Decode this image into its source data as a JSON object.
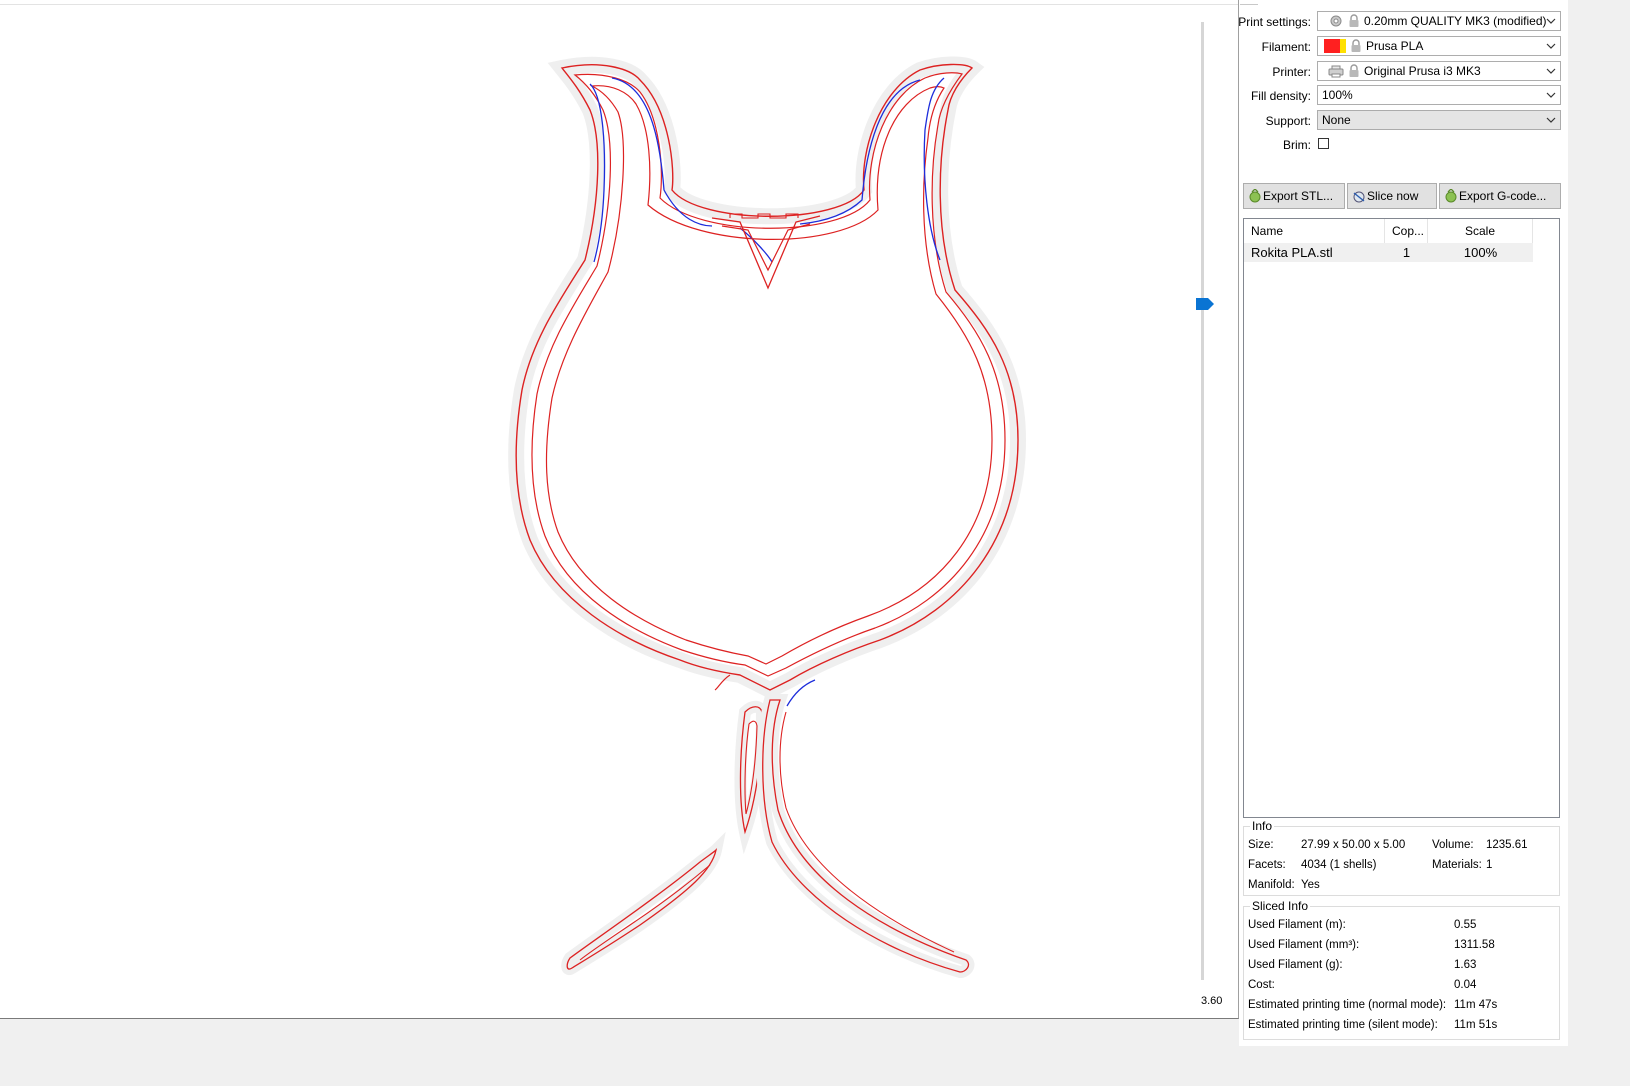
{
  "preview": {
    "layer_value": "3.60",
    "colors": {
      "perimeter": "#dd2222",
      "inner": "#1d2ddb",
      "shadow": "#efefef",
      "thumb": "#0a74d3"
    }
  },
  "settings": {
    "print": {
      "label": "Print settings:",
      "value": "0.20mm QUALITY MK3 (modified)",
      "icon": "gear-icon"
    },
    "filament": {
      "label": "Filament:",
      "value": "Prusa PLA",
      "swatch_colors": [
        "#ff2020",
        "#ffe000"
      ]
    },
    "printer": {
      "label": "Printer:",
      "value": "Original Prusa i3 MK3",
      "icon": "printer-icon"
    },
    "fill_density": {
      "label": "Fill density:",
      "value": "100%"
    },
    "support": {
      "label": "Support:",
      "value": "None"
    },
    "brim": {
      "label": "Brim:",
      "checked": false
    }
  },
  "buttons": {
    "export_stl": "Export STL...",
    "slice_now": "Slice now",
    "export_gcode": "Export G-code..."
  },
  "object_list": {
    "columns": [
      "Name",
      "Cop...",
      "Scale"
    ],
    "rows": [
      {
        "name": "Rokita PLA.stl",
        "copies": "1",
        "scale": "100%"
      }
    ]
  },
  "info": {
    "title": "Info",
    "size_label": "Size:",
    "size": "27.99 x 50.00 x 5.00",
    "volume_label": "Volume:",
    "volume": "1235.61",
    "facets_label": "Facets:",
    "facets": "4034 (1 shells)",
    "materials_label": "Materials:",
    "materials": "1",
    "manifold_label": "Manifold:",
    "manifold": "Yes"
  },
  "sliced_info": {
    "title": "Sliced Info",
    "rows": [
      {
        "label": "Used Filament (m):",
        "value": "0.55"
      },
      {
        "label": "Used Filament (mm³):",
        "value": "1311.58"
      },
      {
        "label": "Used Filament (g):",
        "value": "1.63"
      },
      {
        "label": "Cost:",
        "value": "0.04"
      },
      {
        "label": "Estimated printing time (normal mode):",
        "value": "11m 47s"
      },
      {
        "label": "Estimated printing time (silent mode):",
        "value": "11m 51s"
      }
    ]
  }
}
